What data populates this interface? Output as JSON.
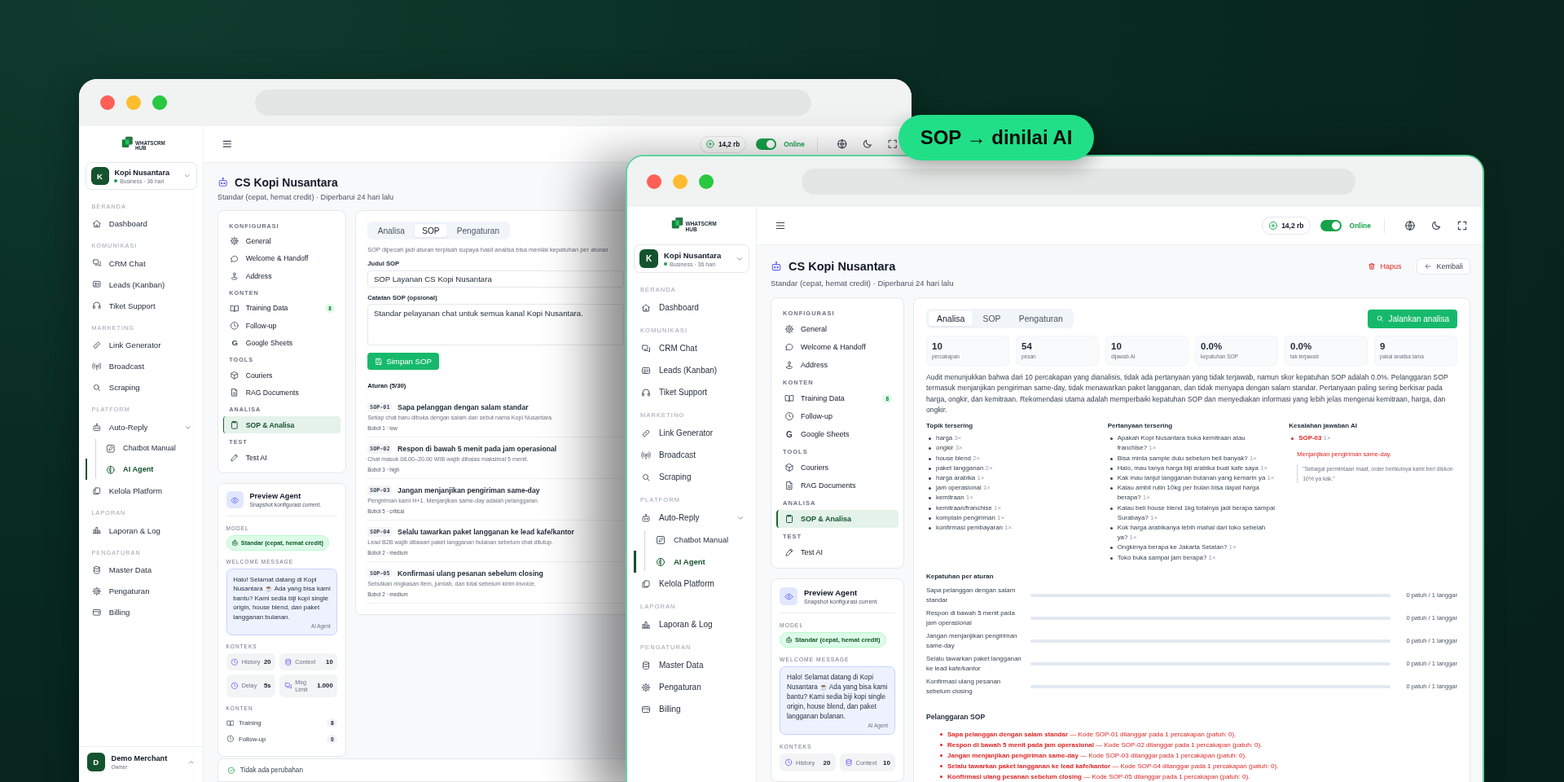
{
  "badge": {
    "label": "SOP → dinilai AI"
  },
  "windows": [
    {
      "sidebar": {
        "brand": "WHATSCRM HUB",
        "workspace": {
          "initial": "K",
          "name": "Kopi Nusantara",
          "plan": "Business · 36 hari"
        },
        "sections": [
          {
            "title": "BERANDA",
            "items": [
              {
                "label": "Dashboard",
                "selected": false
              }
            ]
          },
          {
            "title": "KOMUNIKASI",
            "items": [
              {
                "label": "CRM Chat",
                "selected": false
              },
              {
                "label": "Leads (Kanban)",
                "selected": false
              },
              {
                "label": "Tiket Support",
                "selected": false
              }
            ]
          },
          {
            "title": "MARKETING",
            "items": [
              {
                "label": "Link Generator",
                "selected": false
              },
              {
                "label": "Broadcast",
                "selected": false
              },
              {
                "label": "Scraping",
                "selected": false
              }
            ]
          },
          {
            "title": "PLATFORM",
            "items": [
              {
                "label": "Auto-Reply",
                "selected": false,
                "expanded": true,
                "children": [
                  {
                    "label": "Chatbot Manual",
                    "selected": false
                  },
                  {
                    "label": "AI Agent",
                    "selected": true
                  }
                ]
              },
              {
                "label": "Kelola Platform",
                "selected": false
              }
            ]
          },
          {
            "title": "LAPORAN",
            "items": [
              {
                "label": "Laporan & Log",
                "selected": false
              }
            ]
          },
          {
            "title": "PENGATURAN",
            "items": [
              {
                "label": "Master Data",
                "selected": false
              },
              {
                "label": "Pengaturan",
                "selected": false
              },
              {
                "label": "Billing",
                "selected": false
              }
            ]
          }
        ],
        "user": {
          "initial": "D",
          "name": "Demo Merchant",
          "role": "Owner"
        }
      },
      "topbar": {
        "credits": "14,2 rb",
        "online": true,
        "status": "Online"
      },
      "header": {
        "title": "CS Kopi Nusantara",
        "subtitle": "Standar (cepat, hemat credit) · Diperbarui 24 hari lalu"
      },
      "config": [
        {
          "title": "KONFIGURASI",
          "items": [
            {
              "label": "General",
              "selected": false
            },
            {
              "label": "Welcome & Handoff",
              "selected": false
            },
            {
              "label": "Address",
              "selected": false
            }
          ]
        },
        {
          "title": "KONTEN",
          "items": [
            {
              "label": "Training Data",
              "selected": false,
              "badge": "8"
            },
            {
              "label": "Follow-up",
              "selected": false
            },
            {
              "label": "Google Sheets",
              "selected": false,
              "glyph": "G"
            }
          ]
        },
        {
          "title": "TOOLS",
          "items": [
            {
              "label": "Couriers",
              "selected": false
            },
            {
              "label": "RAG Documents",
              "selected": false
            }
          ]
        },
        {
          "title": "ANALISA",
          "items": [
            {
              "label": "SOP & Analisa",
              "selected": true
            }
          ]
        },
        {
          "title": "TEST",
          "items": [
            {
              "label": "Test AI",
              "selected": false
            }
          ]
        }
      ],
      "preview": {
        "title": "Preview Agent",
        "subtitle": "Snapshot konfigurasi current.",
        "model_label": "MODEL",
        "model": "Standar (cepat, hemat credit)",
        "welcome_label": "WELCOME MESSAGE",
        "welcome": "Halo! Selamat datang di Kopi Nusantara ☕ Ada yang bisa kami bantu? Kami sedia biji kopi single origin, house blend, dan paket langganan bulanan.",
        "welcome_by": "AI Agent",
        "context_label": "KONTEKS",
        "context": [
          {
            "label": "History",
            "value": "20"
          },
          {
            "label": "Context",
            "value": "10"
          },
          {
            "label": "Delay",
            "value": "5s"
          },
          {
            "label": "Msg Limit",
            "value": "1.000"
          }
        ],
        "content_label": "KONTEN",
        "content": [
          {
            "label": "Training",
            "value": "8"
          },
          {
            "label": "Follow-up",
            "value": "0"
          }
        ]
      },
      "save_status": "Tidak ada perubahan",
      "sop": {
        "tabs": [
          {
            "label": "Analisa",
            "selected": false
          },
          {
            "label": "SOP",
            "selected": true
          },
          {
            "label": "Pengaturan",
            "selected": false
          }
        ],
        "intro": "SOP dipecah jadi aturan terpisah supaya hasil analisa bisa menilai kepatuhan per aturan",
        "title_label": "Judul SOP",
        "title_value": "SOP Layanan CS Kopi Nusantara",
        "notes_label": "Catatan SOP (opsional)",
        "notes_value": "Standar pelayanan chat untuk semua kanal Kopi Nusantara.",
        "save": "Simpan SOP",
        "rules_heading": "Aturan (5/30)",
        "rules": [
          {
            "code": "SOP-01",
            "title": "Sapa pelanggan dengan salam standar",
            "description": "Setiap chat baru dibuka dengan salam dan sebut nama Kopi Nusantara.",
            "meta": "Bobot 1 · low"
          },
          {
            "code": "SOP-02",
            "title": "Respon di bawah 5 menit pada jam operasional",
            "description": "Chat masuk 08.00–20.00 WIB wajib dibalas maksimal 5 menit.",
            "meta": "Bobot 3 · high"
          },
          {
            "code": "SOP-03",
            "title": "Jangan menjanjikan pengiriman same-day",
            "description": "Pengiriman kami H+1. Menjanjikan same-day adalah pelanggaran.",
            "meta": "Bobot 5 · critical"
          },
          {
            "code": "SOP-04",
            "title": "Selalu tawarkan paket langganan ke lead kafe/kantor",
            "description": "Lead B2B wajib ditawari paket langganan bulanan sebelum chat ditutup.",
            "meta": "Bobot 2 · medium"
          },
          {
            "code": "SOP-05",
            "title": "Konfirmasi ulang pesanan sebelum closing",
            "description": "Sebutkan ringkasan item, jumlah, dan total sebelum kirim invoice.",
            "meta": "Bobot 2 · medium"
          }
        ]
      }
    },
    {
      "sidebar": {
        "brand": "WHATSCRM HUB",
        "workspace": {
          "initial": "K",
          "name": "Kopi Nusantara",
          "plan": "Business · 36 hari"
        },
        "sections": [
          {
            "title": "BERANDA",
            "items": [
              {
                "label": "Dashboard",
                "selected": false
              }
            ]
          },
          {
            "title": "KOMUNIKASI",
            "items": [
              {
                "label": "CRM Chat",
                "selected": false
              },
              {
                "label": "Leads (Kanban)",
                "selected": false
              },
              {
                "label": "Tiket Support",
                "selected": false
              }
            ]
          },
          {
            "title": "MARKETING",
            "items": [
              {
                "label": "Link Generator",
                "selected": false
              },
              {
                "label": "Broadcast",
                "selected": false
              },
              {
                "label": "Scraping",
                "selected": false
              }
            ]
          },
          {
            "title": "PLATFORM",
            "items": [
              {
                "label": "Auto-Reply",
                "selected": false,
                "expanded": true,
                "children": [
                  {
                    "label": "Chatbot Manual",
                    "selected": false
                  },
                  {
                    "label": "AI Agent",
                    "selected": true
                  }
                ]
              },
              {
                "label": "Kelola Platform",
                "selected": false
              }
            ]
          },
          {
            "title": "LAPORAN",
            "items": [
              {
                "label": "Laporan & Log",
                "selected": false
              }
            ]
          },
          {
            "title": "PENGATURAN",
            "items": [
              {
                "label": "Master Data",
                "selected": false
              },
              {
                "label": "Pengaturan",
                "selected": false
              },
              {
                "label": "Billing",
                "selected": false
              }
            ]
          }
        ]
      },
      "topbar": {
        "credits": "14,2 rb",
        "online": true,
        "status": "Online"
      },
      "header": {
        "title": "CS Kopi Nusantara",
        "subtitle": "Standar (cepat, hemat credit) · Diperbarui 24 hari lalu",
        "actions": [
          {
            "kind": "delete",
            "label": "Hapus"
          },
          {
            "kind": "back",
            "label": "Kembali"
          }
        ]
      },
      "config": [
        {
          "title": "KONFIGURASI",
          "items": [
            {
              "label": "General",
              "selected": false
            },
            {
              "label": "Welcome & Handoff",
              "selected": false
            },
            {
              "label": "Address",
              "selected": false
            }
          ]
        },
        {
          "title": "KONTEN",
          "items": [
            {
              "label": "Training Data",
              "selected": false,
              "badge": "8"
            },
            {
              "label": "Follow-up",
              "selected": false
            },
            {
              "label": "Google Sheets",
              "selected": false,
              "glyph": "G"
            }
          ]
        },
        {
          "title": "TOOLS",
          "items": [
            {
              "label": "Couriers",
              "selected": false
            },
            {
              "label": "RAG Documents",
              "selected": false
            }
          ]
        },
        {
          "title": "ANALISA",
          "items": [
            {
              "label": "SOP & Analisa",
              "selected": true
            }
          ]
        },
        {
          "title": "TEST",
          "items": [
            {
              "label": "Test AI",
              "selected": false
            }
          ]
        }
      ],
      "preview": {
        "title": "Preview Agent",
        "subtitle": "Snapshot konfigurasi current.",
        "model_label": "MODEL",
        "model": "Standar (cepat, hemat credit)",
        "welcome_label": "WELCOME MESSAGE",
        "welcome": "Halo! Selamat datang di Kopi Nusantara ☕ Ada yang bisa kami bantu? Kami sedia biji kopi single origin, house blend, dan paket langganan bulanan.",
        "welcome_by": "AI Agent",
        "context_label": "KONTEKS",
        "context": [
          {
            "label": "History",
            "value": "20"
          },
          {
            "label": "Context",
            "value": "10"
          }
        ]
      },
      "analysis": {
        "tabs": [
          {
            "label": "Analisa",
            "selected": true
          },
          {
            "label": "SOP",
            "selected": false
          },
          {
            "label": "Pengaturan",
            "selected": false
          }
        ],
        "run": "Jalankan analisa",
        "stats": [
          {
            "value": "10",
            "label": "percakapan"
          },
          {
            "value": "54",
            "label": "pesan"
          },
          {
            "value": "10",
            "label": "dijawab AI"
          },
          {
            "value": "0.0%",
            "label": "kepatuhan SOP"
          },
          {
            "value": "0.0%",
            "label": "tak terjawab"
          },
          {
            "value": "9",
            "label": "pakai analisa lama"
          }
        ],
        "summary": "Audit menunjukkan bahwa dari 10 percakapan yang dianalisis, tidak ada pertanyaan yang tidak terjawab, namun skor kepatuhan SOP adalah 0.0%. Pelanggaran SOP termasuk menjanjikan pengiriman same-day, tidak menawarkan paket langganan, dan tidak menyapa dengan salam standar. Pertanyaan paling sering berkisar pada harga, ongkir, dan kemitraan. Rekomendasi utama adalah memperbaiki kepatuhan SOP dan menyediakan informasi yang lebih jelas mengenai kemitraan, harga, dan ongkir.",
        "topics": {
          "title": "Topik tersering",
          "items": [
            {
              "text": "harga",
              "count": "3×"
            },
            {
              "text": "ongkir",
              "count": "3×"
            },
            {
              "text": "house blend",
              "count": "2×"
            },
            {
              "text": "paket langganan",
              "count": "2×"
            },
            {
              "text": "harga arabika",
              "count": "1×"
            },
            {
              "text": "jam operasional",
              "count": "1×"
            },
            {
              "text": "kemitraan",
              "count": "1×"
            },
            {
              "text": "kemitraan/franchise",
              "count": "1×"
            },
            {
              "text": "komplain pengiriman",
              "count": "1×"
            },
            {
              "text": "konfirmasi pembayaran",
              "count": "1×"
            }
          ]
        },
        "questions": {
          "title": "Pertanyaan tersering",
          "items": [
            {
              "text": "Apakah Kopi Nusantara buka kemitraan atau franchise?",
              "count": "1×"
            },
            {
              "text": "Bisa minta sample dulu sebelum beli banyak?",
              "count": "1×"
            },
            {
              "text": "Halo, mau tanya harga biji arabika buat kafe saya",
              "count": "1×"
            },
            {
              "text": "Kak mau lanjut langganan bulanan yang kemarin ya",
              "count": "1×"
            },
            {
              "text": "Kalau ambil rutin 10kg per bulan bisa dapat harga berapa?",
              "count": "1×"
            },
            {
              "text": "Kalau beli house blend 1kg totalnya jadi berapa sampai Surabaya?",
              "count": "1×"
            },
            {
              "text": "Kok harga arabikanya lebih mahal dari toko sebelah ya?",
              "count": "1×"
            },
            {
              "text": "Ongkirnya berapa ke Jakarta Selatan?",
              "count": "1×"
            },
            {
              "text": "Toko buka sampai jam berapa?",
              "count": "1×"
            }
          ]
        },
        "errors": {
          "title": "Kesalahan jawaban AI",
          "items": [
            {
              "code": "SOP-03",
              "count": "1×",
              "note": "Menjanjikan pengiriman same-day.",
              "quote": "\"Sebagai permintaan maaf, order berikutnya kami beri diskon 10% ya kak.\""
            }
          ]
        },
        "compliance": {
          "title": "Kepatuhan per aturan",
          "rows": [
            {
              "label": "Sapa pelanggan dengan salam standar",
              "level": 0,
              "reading": "0 patuh / 1 langgar"
            },
            {
              "label": "Respon di bawah 5 menit pada jam operasional",
              "level": 0,
              "reading": "0 patuh / 1 langgar"
            },
            {
              "label": "Jangan menjanjikan pengiriman same-day",
              "level": 0,
              "reading": "0 patuh / 1 langgar"
            },
            {
              "label": "Selalu tawarkan paket langganan ke lead kafe/kantor",
              "level": 0,
              "reading": "0 patuh / 1 langgar"
            },
            {
              "label": "Konfirmasi ulang pesanan sebelum closing",
              "level": 0,
              "reading": "0 patuh / 1 langgar"
            }
          ]
        },
        "violations": {
          "title": "Pelanggaran SOP",
          "items": [
            {
              "rule": "Sapa pelanggan dengan salam standar",
              "detail": "— Kode SOP-01 dilanggar pada 1 percakapan (patuh: 0)."
            },
            {
              "rule": "Respon di bawah 5 menit pada jam operasional",
              "detail": "— Kode SOP-02 dilanggar pada 1 percakapan (patuh: 0)."
            },
            {
              "rule": "Jangan menjanjikan pengiriman same-day",
              "detail": "— Kode SOP-03 dilanggar pada 1 percakapan (patuh: 0)."
            },
            {
              "rule": "Selalu tawarkan paket langganan ke lead kafe/kantor",
              "detail": "— Kode SOP-04 dilanggar pada 1 percakapan (patuh: 0)."
            },
            {
              "rule": "Konfirmasi ulang pesanan sebelum closing",
              "detail": "— Kode SOP-05 dilanggar pada 1 percakapan (patuh: 0)."
            }
          ]
        }
      }
    }
  ]
}
